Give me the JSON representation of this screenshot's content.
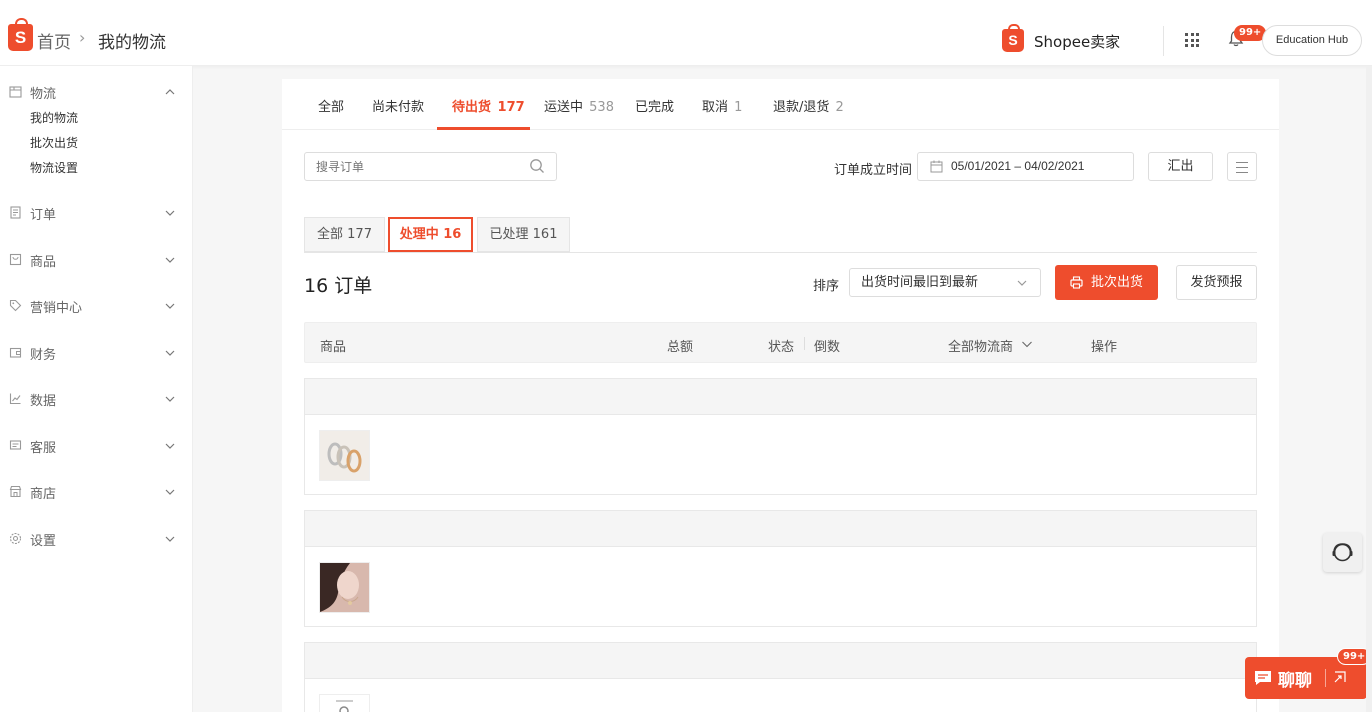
{
  "breadcrumb": {
    "home": "首页",
    "separator": "›",
    "current": "我的物流"
  },
  "header": {
    "brand": "Shopee卖家",
    "notification_badge": "99+",
    "education_hub": "Education Hub"
  },
  "sidebar": {
    "groups": [
      {
        "label": "物流",
        "icon": "box-icon",
        "expanded": true,
        "items": [
          "我的物流",
          "批次出货",
          "物流设置"
        ]
      },
      {
        "label": "订单",
        "icon": "clipboard-icon",
        "expanded": false
      },
      {
        "label": "商品",
        "icon": "bag-icon",
        "expanded": false
      },
      {
        "label": "营销中心",
        "icon": "tag-icon",
        "expanded": false
      },
      {
        "label": "财务",
        "icon": "wallet-icon",
        "expanded": false
      },
      {
        "label": "数据",
        "icon": "chart-icon",
        "expanded": false
      },
      {
        "label": "客服",
        "icon": "message-icon",
        "expanded": false
      },
      {
        "label": "商店",
        "icon": "shop-icon",
        "expanded": false
      },
      {
        "label": "设置",
        "icon": "gear-icon",
        "expanded": false
      }
    ]
  },
  "tabs": [
    {
      "label": "全部",
      "count": ""
    },
    {
      "label": "尚未付款",
      "count": ""
    },
    {
      "label": "待出货",
      "count": "177",
      "active": true
    },
    {
      "label": "运送中",
      "count": "538"
    },
    {
      "label": "已完成",
      "count": ""
    },
    {
      "label": "取消",
      "count": "1"
    },
    {
      "label": "退款/退货",
      "count": "2"
    }
  ],
  "search": {
    "placeholder": "搜寻订单"
  },
  "date_filter": {
    "label": "订单成立时间",
    "value": "05/01/2021 – 04/02/2021"
  },
  "export_label": "汇出",
  "subtabs": [
    {
      "label": "全部 177"
    },
    {
      "label": "处理中 16",
      "active": true
    },
    {
      "label": "已处理 161"
    }
  ],
  "orders_count": "16 订单",
  "sort": {
    "label": "排序",
    "value": "出货时间最旧到最新"
  },
  "batch_ship_label": "批次出货",
  "ship_preview_label": "发货预报",
  "table_headers": {
    "product": "商品",
    "total": "总额",
    "status": "状态",
    "countdown": "倒数",
    "carrier": "全部物流商",
    "action": "操作"
  },
  "chat": {
    "label": "聊聊",
    "badge": "99+"
  },
  "colors": {
    "accent": "#ee4d2d"
  }
}
